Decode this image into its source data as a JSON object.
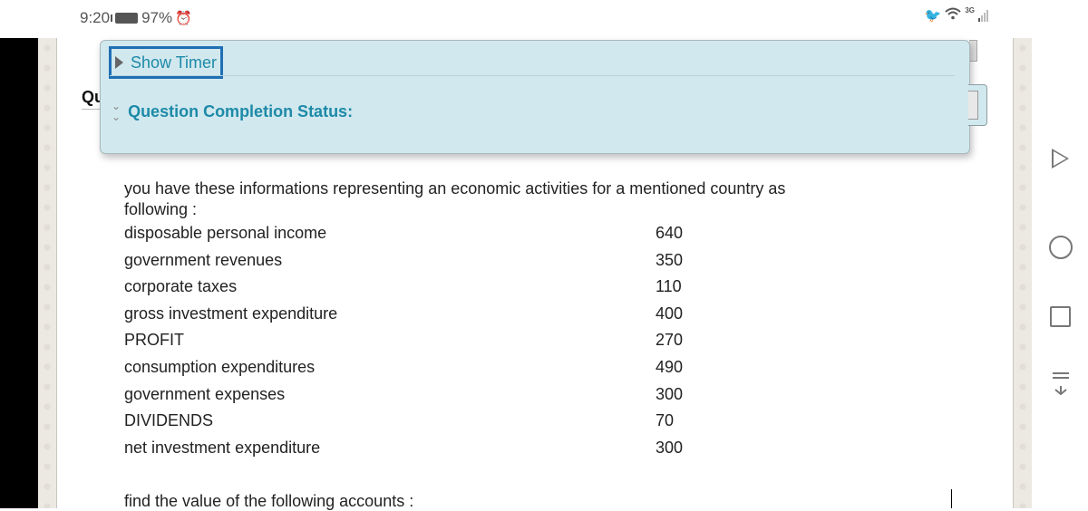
{
  "status_bar": {
    "time": "9:20",
    "battery_percent": "97%",
    "battery_level": 0.97,
    "network_type": "3G",
    "icons": [
      "battery-icon",
      "alarm-icon",
      "twitter-icon",
      "wifi-icon",
      "signal-icon"
    ]
  },
  "page": {
    "question_heading": "Qu"
  },
  "panel": {
    "timer_toggle_label": "Show Timer",
    "completion_status_label": "Question Completion Status:"
  },
  "question": {
    "intro_line1": "you have these informations representing an economic activities for a mentioned country as",
    "intro_line2": "following :",
    "items": [
      {
        "label": "disposable personal income",
        "value": "640"
      },
      {
        "label": "government revenues",
        "value": "350"
      },
      {
        "label": "corporate taxes",
        "value": "110"
      },
      {
        "label": "gross investment expenditure",
        "value": "400"
      },
      {
        "label": "PROFIT",
        "value": "270"
      },
      {
        "label": "consumption expenditures",
        "value": "490"
      },
      {
        "label": "government expenses",
        "value": "300"
      },
      {
        "label": "DIVIDENDS",
        "value": "70"
      },
      {
        "label": "net investment expenditure",
        "value": "300"
      }
    ],
    "find_text": "find the value of the following accounts :"
  },
  "nav_bar": {
    "buttons": [
      "back",
      "home",
      "recent-apps",
      "notification-dropdown"
    ]
  }
}
